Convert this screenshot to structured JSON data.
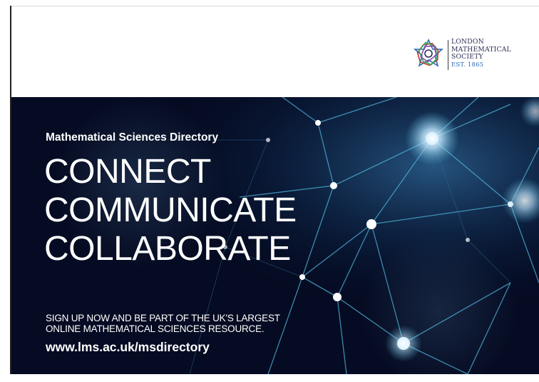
{
  "logo": {
    "icon": "lms-star-icon",
    "lines": [
      "LONDON",
      "MATHEMATICAL",
      "SOCIETY"
    ],
    "established": "EST. 1865"
  },
  "banner": {
    "subtitle": "Mathematical Sciences Directory",
    "headline": [
      "CONNECT",
      "COMMUNICATE",
      "COLLABORATE"
    ],
    "signup": [
      "SIGN UP NOW AND BE PART OF THE UK'S LARGEST",
      "ONLINE MATHEMATICAL SCIENCES RESOURCE."
    ],
    "url": "www.lms.ac.uk/msdirectory"
  },
  "colors": {
    "panel_background": "#050b22",
    "network_lines": "#4fb3d9",
    "logo_text": "#2a2f55",
    "logo_accent": "#2e6bb5",
    "text": "#ffffff"
  }
}
